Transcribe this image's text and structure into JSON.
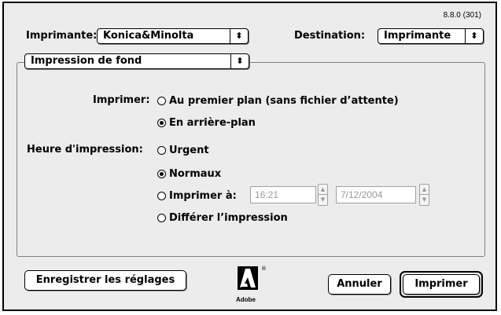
{
  "version": "8.8.0 (301)",
  "header": {
    "printer_label": "Imprimante:",
    "printer_value": "Konica&Minolta",
    "destination_label": "Destination:",
    "destination_value": "Imprimante"
  },
  "panel": {
    "popup_value": "Impression de fond",
    "print_label": "Imprimer:",
    "print_options": [
      "Au premier plan (sans fichier d’attente)",
      "En arrière-plan"
    ],
    "print_selected": 1,
    "time_label": "Heure d'impression:",
    "time_options": [
      "Urgent",
      "Normaux",
      "Imprimer à:",
      "Différer l’impression"
    ],
    "time_selected": 1,
    "time_value": "16:21",
    "date_value": "7/12/2004"
  },
  "footer": {
    "save_settings": "Enregistrer les réglages",
    "cancel": "Annuler",
    "print": "Imprimer",
    "logo_text": "Adobe",
    "logo_mark": "®"
  },
  "icons": {
    "popup_arrows": "updown-arrows-icon",
    "logo": "adobe-logo"
  }
}
